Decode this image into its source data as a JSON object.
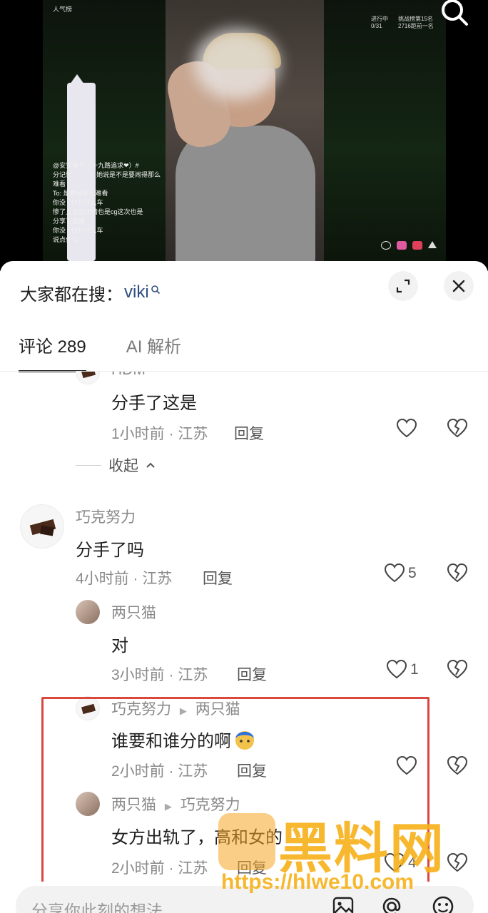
{
  "video": {
    "tag": "人气榜",
    "stat_line1": "进行中",
    "stat_line2": "0/31",
    "rank_line1": "挑战榜第15名",
    "rank_line2": "2716距前一名",
    "chat": [
      "@安安有个（十九路追求❤）#",
      "分记忆(￣_￣): 她说是不是要闹得那么",
      "难看",
      "To:  是要闹那么难看",
      "你没   : 你开什么车",
      "       惨了上次爸比晴也是cg这次也是",
      "       分享了直播",
      "你没   : 你开什么车",
      "说点什么"
    ]
  },
  "header": {
    "hot_prefix": "大家都在搜：",
    "hot_keyword": "viki"
  },
  "tabs": [
    {
      "label": "评论 289",
      "active": true
    },
    {
      "label": "AI 解析",
      "active": false
    }
  ],
  "comments": {
    "top_cut_name": "HDM",
    "top": {
      "text": "分手了这是",
      "meta": "1小时前 · 江苏",
      "reply": "回复"
    },
    "collapse_label": "收起",
    "main": {
      "user": "巧克努力",
      "text": "分手了吗",
      "meta": "4小时前 · 江苏",
      "reply": "回复",
      "likes": "5"
    },
    "reply1": {
      "user": "两只猫",
      "text": "对",
      "meta": "3小时前 · 江苏",
      "reply": "回复",
      "likes": "1"
    },
    "reply2": {
      "user": "巧克努力",
      "target": "两只猫",
      "text": "谁要和谁分的啊",
      "meta": "2小时前 · 江苏",
      "reply": "回复"
    },
    "reply3": {
      "user": "两只猫",
      "target": "巧克努力",
      "text": "女方出轨了，高和女的",
      "meta": "2小时前 · 江苏",
      "reply": "回复",
      "likes": "4"
    }
  },
  "watermark": {
    "title": "黑料网",
    "url": "https://hlwe10.com"
  },
  "input": {
    "placeholder": "分享你此刻的想法"
  },
  "colors": {
    "link": "#2f4f80",
    "highlight_box": "#d9473f",
    "watermark": "#f6b018"
  }
}
